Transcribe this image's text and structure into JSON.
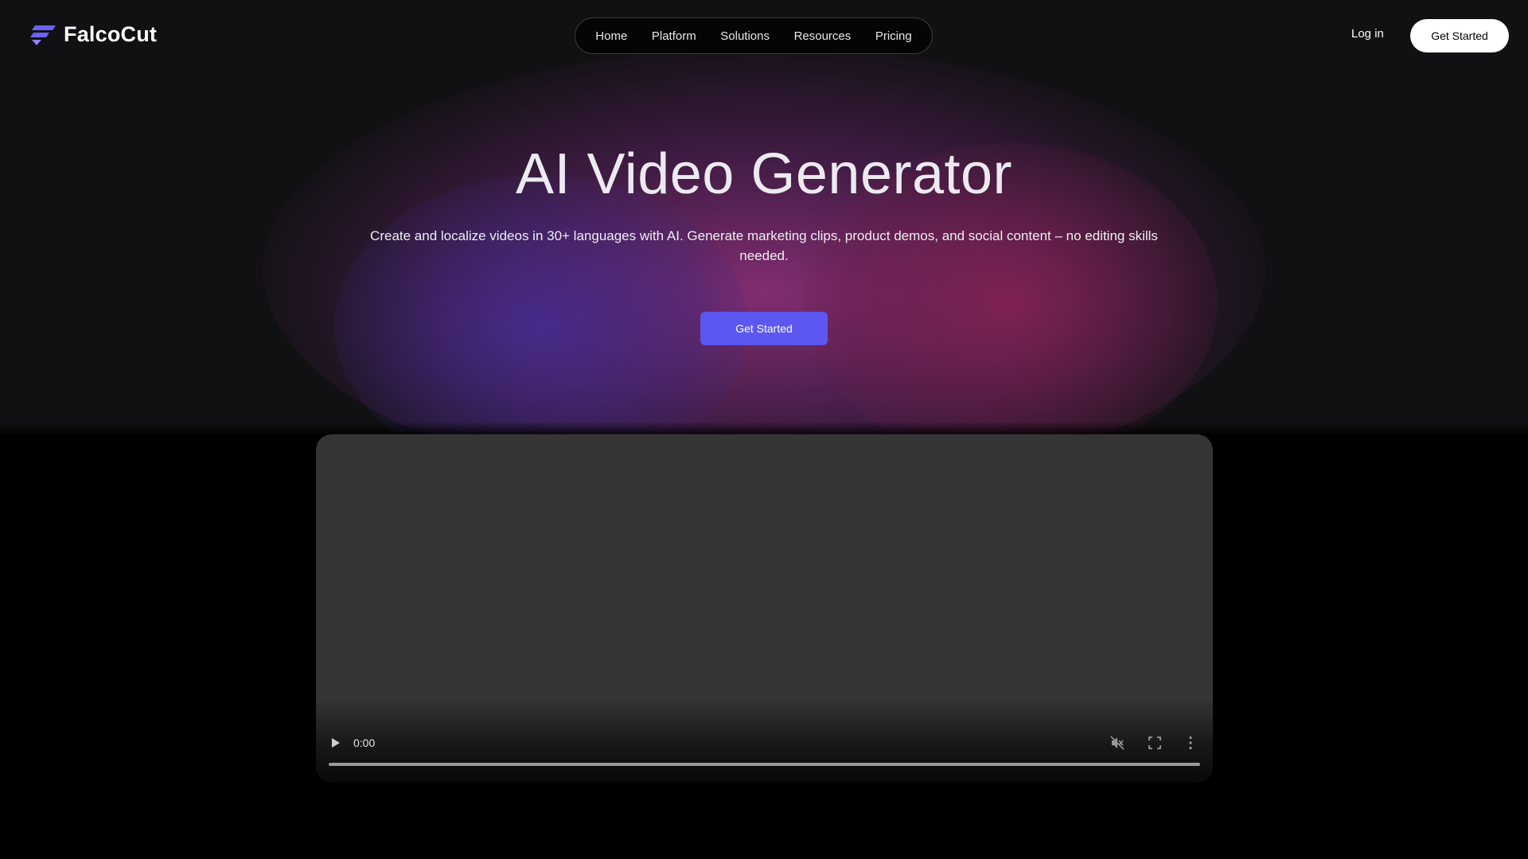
{
  "brand": {
    "name": "FalcoCut",
    "logo_icon": "falcon-stripes-logo",
    "accent_color": "#5b57f0"
  },
  "nav": {
    "items": [
      {
        "label": "Home"
      },
      {
        "label": "Platform"
      },
      {
        "label": "Solutions"
      },
      {
        "label": "Resources"
      },
      {
        "label": "Pricing"
      }
    ]
  },
  "header": {
    "login_label": "Log in",
    "cta_label": "Get Started"
  },
  "hero": {
    "title": "AI Video Generator",
    "subtitle": "Create and localize videos in 30+ languages with AI. Generate marketing clips, product demos, and social content – no editing skills needed.",
    "cta_label": "Get Started"
  },
  "video": {
    "current_time": "0:00",
    "progress": 0,
    "muted": true,
    "icons": [
      "play-icon",
      "muted-volume-icon",
      "fullscreen-icon",
      "more-options-icon"
    ]
  }
}
